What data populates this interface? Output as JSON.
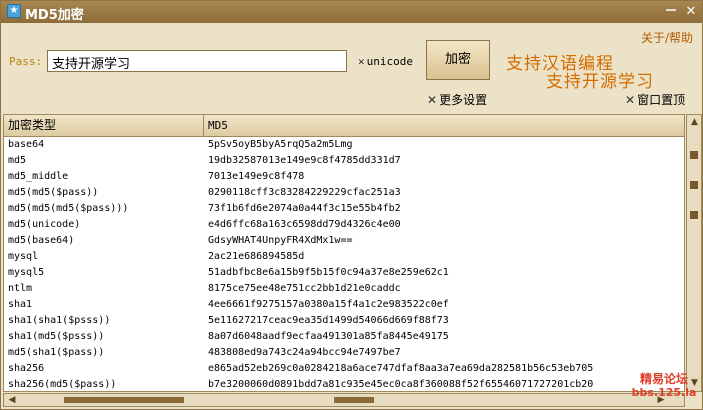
{
  "window": {
    "title": "MD5加密",
    "controls": {
      "minimize": "－",
      "close": "✕"
    }
  },
  "toolbar": {
    "pass_label": "Pass:",
    "pass_value": "支持开源学习",
    "unicode_label": "unicode",
    "encrypt_label": "加密",
    "more_settings_label": "更多设置",
    "window_top_label": "窗口置顶",
    "about_label": "关于/帮助",
    "promo_line1": "支持汉语编程",
    "promo_line2": "支持开源学习"
  },
  "grid": {
    "columns": [
      "加密类型",
      "MD5"
    ],
    "rows": [
      {
        "type": "base64",
        "value": "5pSv5oyB5byA5rqQ5a2m5Lmg"
      },
      {
        "type": "md5",
        "value": "19db32587013e149e9c8f4785dd331d7"
      },
      {
        "type": "md5_middle",
        "value": "7013e149e9c8f478"
      },
      {
        "type": "md5(md5($pass))",
        "value": "0290118cff3c83284229229cfac251a3"
      },
      {
        "type": "md5(md5(md5($pass)))",
        "value": "73f1b6fd6e2074a0a44f3c15e55b4fb2"
      },
      {
        "type": "md5(unicode)",
        "value": "e4d6ffc68a163c6598dd79d4326c4e00"
      },
      {
        "type": "md5(base64)",
        "value": "GdsyWHAT4UnpyFR4XdMx1w=="
      },
      {
        "type": "mysql",
        "value": "2ac21e686894585d"
      },
      {
        "type": "mysql5",
        "value": "51adbfbc8e6a15b9f5b15f0c94a37e8e259e62c1"
      },
      {
        "type": "ntlm",
        "value": "8175ce75ee48e751cc2bb1d21e0caddc"
      },
      {
        "type": "sha1",
        "value": "4ee6661f9275157a0380a15f4a1c2e983522c0ef"
      },
      {
        "type": "sha1(sha1($psss))",
        "value": "5e11627217ceac9ea35d1499d54066d669f88f73"
      },
      {
        "type": "sha1(md5($psss))",
        "value": "8a07d6048aadf9ecfaa491301a85fa8445e49175"
      },
      {
        "type": "md5(sha1($pass))",
        "value": "483808ed9a743c24a94bcc94e7497be7"
      },
      {
        "type": "sha256",
        "value": "e865ad52eb269c0a0284218a6ace747dfaf8aa3a7ea69da282581b56c53eb705"
      },
      {
        "type": "sha256(md5($pass))",
        "value": "b7e3200060d0891bdd7a81c935e45ec0ca8f360088f52f65546071727201cb20"
      }
    ]
  },
  "watermark": {
    "line1": "精易论坛",
    "line2": "bbs.125.la"
  },
  "colors": {
    "accent": "#d46c00",
    "title_bar": "#9a7844",
    "background": "#ece2c7"
  }
}
